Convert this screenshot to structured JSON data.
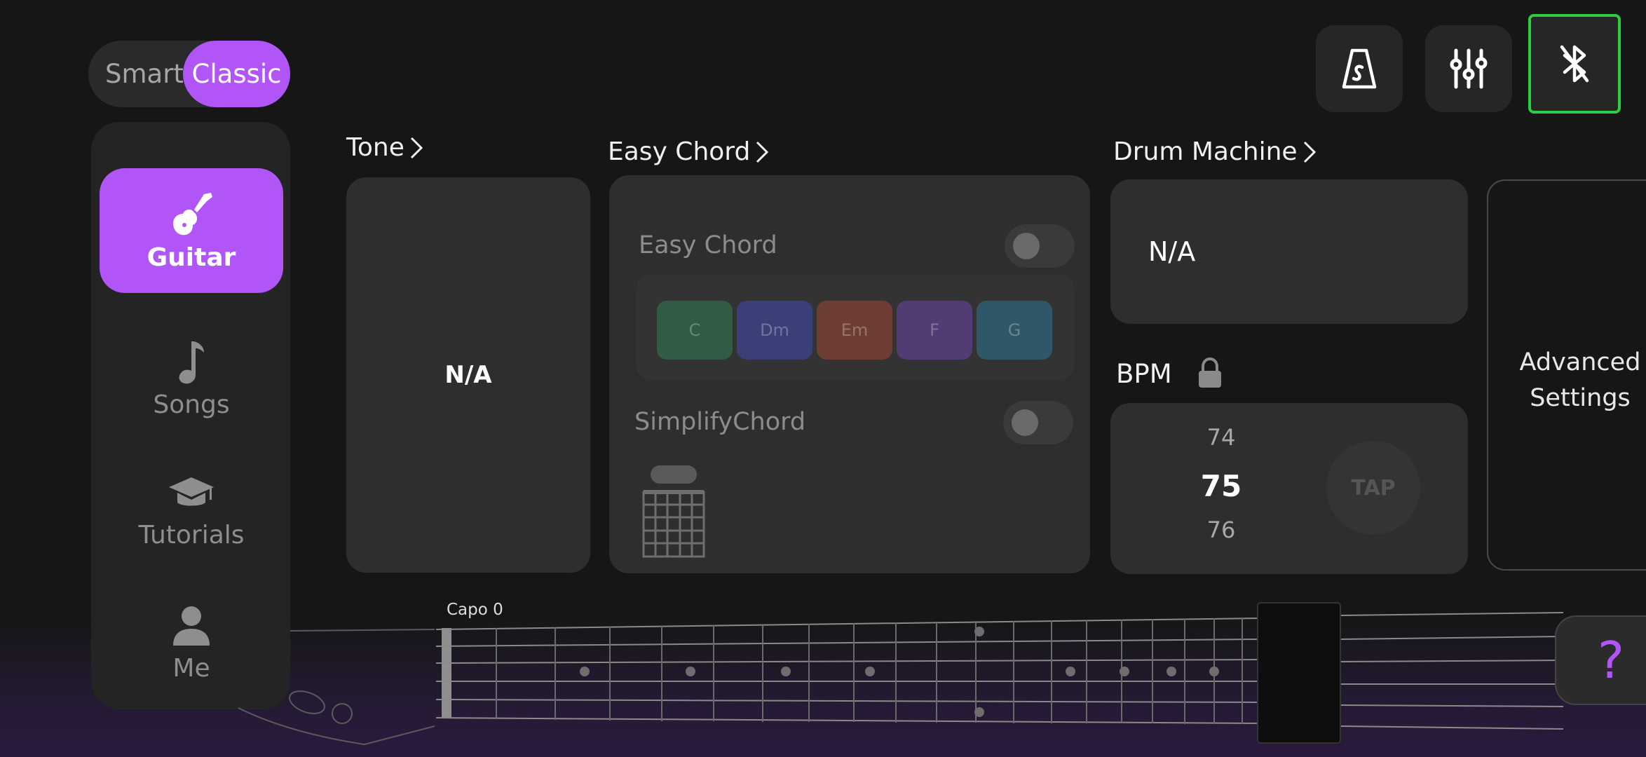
{
  "mode_toggle": {
    "smart": "Smart",
    "classic": "Classic",
    "selected": "Classic"
  },
  "top_buttons": [
    {
      "name": "metronome",
      "icon": "metronome-icon"
    },
    {
      "name": "mixer",
      "icon": "sliders-icon"
    },
    {
      "name": "bluetooth",
      "icon": "bluetooth-off-icon"
    }
  ],
  "sidebar": {
    "items": [
      {
        "label": "Guitar",
        "icon": "electric-guitar-icon",
        "active": true
      },
      {
        "label": "Songs",
        "icon": "music-note-icon",
        "active": false
      },
      {
        "label": "Tutorials",
        "icon": "graduation-cap-icon",
        "active": false
      },
      {
        "label": "Me",
        "icon": "user-icon",
        "active": false
      }
    ]
  },
  "tone": {
    "title": "Tone",
    "value": "N/A"
  },
  "easy_chord": {
    "title": "Easy Chord",
    "toggle_label": "Easy Chord",
    "toggle_on": false,
    "chords": [
      {
        "label": "C",
        "color": "#2f5c43"
      },
      {
        "label": "Dm",
        "color": "#3a3f77"
      },
      {
        "label": "Em",
        "color": "#6e3d33"
      },
      {
        "label": "F",
        "color": "#533b73"
      },
      {
        "label": "G",
        "color": "#2e5767"
      }
    ],
    "simplify_label": "SimplifyChord",
    "simplify_on": false
  },
  "drum_machine": {
    "title": "Drum Machine",
    "value": "N/A",
    "bpm_label": "BPM",
    "bpm_prev": "74",
    "bpm_current": "75",
    "bpm_next": "76",
    "tap_label": "TAP"
  },
  "advanced": {
    "line1": "Advanced",
    "line2": "Settings"
  },
  "fretboard": {
    "capo_label": "Capo 0"
  },
  "help": {
    "label": "?"
  },
  "colors": {
    "accent": "#b155f6",
    "bluetooth_highlight": "#2ecc40",
    "background": "#161616",
    "card": "#2e2e2e"
  }
}
